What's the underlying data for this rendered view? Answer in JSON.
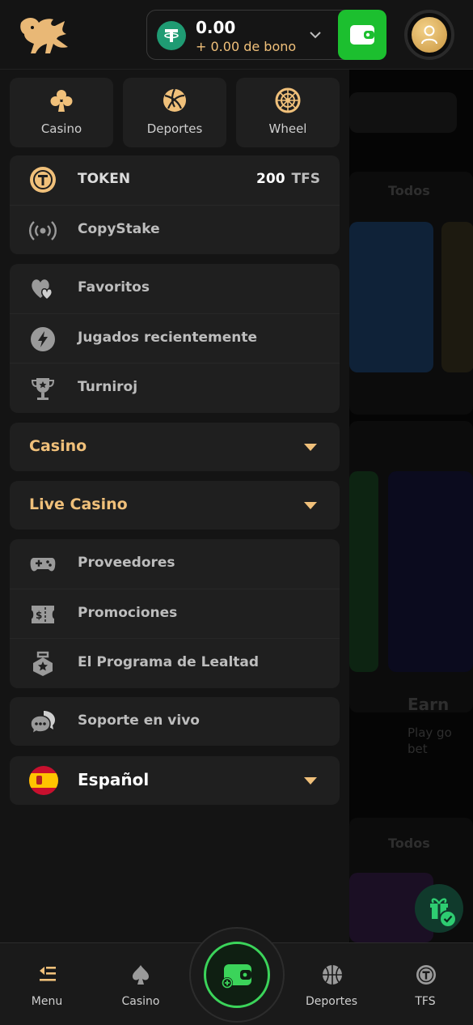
{
  "header": {
    "balance_amount": "0.00",
    "bonus_text": "+ 0.00 de bono"
  },
  "top_tiles": [
    {
      "label": "Casino",
      "icon": "clubs-icon"
    },
    {
      "label": "Deportes",
      "icon": "volleyball-icon"
    },
    {
      "label": "Wheel",
      "icon": "wheel-icon"
    }
  ],
  "token_card": {
    "token_label": "TOKEN",
    "token_value": "200",
    "token_unit": "TFS",
    "copystake_label": "CopyStake"
  },
  "user_card": {
    "favoritos": "Favoritos",
    "recientes": "Jugados recientemente",
    "turniroj": "Turniroj"
  },
  "accordions": {
    "casino": "Casino",
    "live_casino": "Live Casino"
  },
  "more_card": {
    "proveedores": "Proveedores",
    "promociones": "Promociones",
    "lealtad": "El Programa de Lealtad"
  },
  "support": {
    "label": "Soporte en vivo"
  },
  "language": {
    "label": "Español"
  },
  "bottom_nav": {
    "menu": "Menu",
    "casino": "Casino",
    "deportes": "Deportes",
    "tfs": "TFS"
  },
  "background": {
    "todos_1": "Todos",
    "todos_2": "Todos",
    "earn": "Earn",
    "play_text": "Play go",
    "bet_text": "bet"
  },
  "colors": {
    "accent_gold": "#f0c07a",
    "wallet_green": "#1cbf2f",
    "panel": "#1f1f1f",
    "background": "#141414"
  }
}
